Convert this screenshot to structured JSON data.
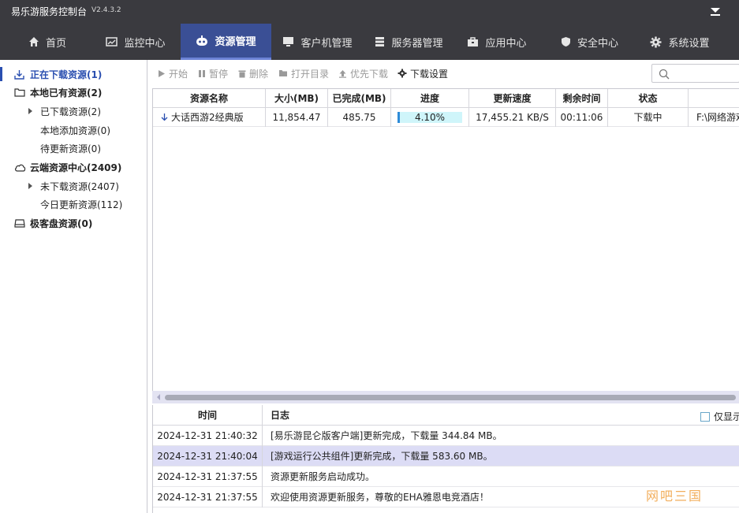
{
  "app": {
    "title": "易乐游服务控制台",
    "version": "V2.4.3.2"
  },
  "nav": {
    "items": [
      {
        "label": "首页",
        "icon": "home-icon"
      },
      {
        "label": "监控中心",
        "icon": "monitor-chart-icon"
      },
      {
        "label": "资源管理",
        "icon": "resource-bot-icon",
        "active": true
      },
      {
        "label": "客户机管理",
        "icon": "client-monitor-icon"
      },
      {
        "label": "服务器管理",
        "icon": "server-icon"
      },
      {
        "label": "应用中心",
        "icon": "app-bag-icon"
      },
      {
        "label": "安全中心",
        "icon": "shield-icon"
      },
      {
        "label": "系统设置",
        "icon": "gear-icon"
      }
    ],
    "active_color": "#3a4f95"
  },
  "sidebar": {
    "items": [
      {
        "label": "正在下载资源(1)",
        "icon": "download-icon",
        "active": true
      },
      {
        "label": "本地已有资源(2)",
        "icon": "folder-icon"
      },
      {
        "label": "已下载资源(2)",
        "icon": "expand-arrow-icon"
      },
      {
        "label": "本地添加资源(0)"
      },
      {
        "label": "待更新资源(0)"
      },
      {
        "label": "云端资源中心(2409)",
        "icon": "cloud-icon"
      },
      {
        "label": "未下载资源(2407)",
        "icon": "expand-arrow-icon"
      },
      {
        "label": "今日更新资源(112)"
      },
      {
        "label": "极客盘资源(0)",
        "icon": "disk-icon"
      }
    ]
  },
  "toolbar": {
    "start": "开始",
    "pause": "暂停",
    "delete": "删除",
    "open_dir": "打开目录",
    "priority": "优先下载",
    "settings": "下载设置",
    "search_placeholder": ""
  },
  "downloads": {
    "columns": [
      "资源名称",
      "大小(MB)",
      "已完成(MB)",
      "进度",
      "更新速度",
      "剩余时间",
      "状态"
    ],
    "rows": [
      {
        "name": "大话西游2经典版",
        "size": "11,854.47",
        "done": "485.75",
        "progress_text": "4.10%",
        "progress": 0.041,
        "speed": "17,455.21 KB/S",
        "remaining": "00:11:06",
        "status": "下载中",
        "path": "F:\\网络游戏"
      }
    ]
  },
  "log": {
    "columns": [
      "时间",
      "日志"
    ],
    "only_show_label": "仅显示",
    "rows": [
      {
        "time": "2024-12-31 21:40:32",
        "message": "[易乐游昆仑版客户端]更新完成，下载量 344.84 MB。"
      },
      {
        "time": "2024-12-31 21:40:04",
        "message": "[游戏运行公共组件]更新完成，下载量 583.60 MB。",
        "highlight": true
      },
      {
        "time": "2024-12-31 21:37:55",
        "message": "资源更新服务启动成功。"
      },
      {
        "time": "2024-12-31 21:37:55",
        "message": "欢迎使用资源更新服务，尊敬的EHA雅恩电竞酒店！"
      }
    ]
  },
  "watermark": "网吧三国"
}
